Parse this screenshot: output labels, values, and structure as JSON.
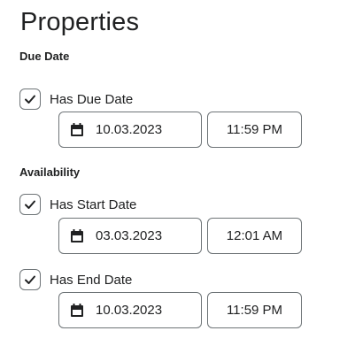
{
  "page": {
    "title": "Properties"
  },
  "due_date": {
    "heading": "Due Date",
    "checkbox_label": "Has Due Date",
    "checked": true,
    "date": "10.03.2023",
    "time": "11:59 PM"
  },
  "availability": {
    "heading": "Availability",
    "start": {
      "checkbox_label": "Has Start Date",
      "checked": true,
      "date": "03.03.2023",
      "time": "12:01 AM"
    },
    "end": {
      "checkbox_label": "Has End Date",
      "checked": true,
      "date": "10.03.2023",
      "time": "11:59 PM"
    }
  },
  "icons": {
    "checkbox": "checkmark-icon",
    "date": "calendar-icon"
  },
  "colors": {
    "text": "#202122",
    "border": "#6e7477",
    "background": "#ffffff"
  }
}
